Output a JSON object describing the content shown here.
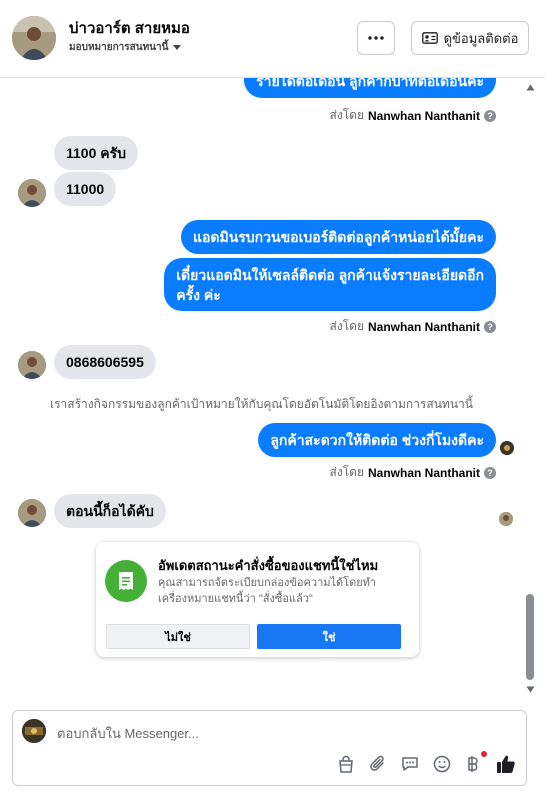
{
  "header": {
    "name": "บ่าวอาร์ต สายหมอ",
    "assign_label": "มอบหมายการสนทนานี้",
    "contact_button": "ดูข้อมูลติดต่อ"
  },
  "messages": {
    "top_partial": "รายได้ต่อเดือน ลูกค้ากี่บาทต่อเดือนคะ",
    "sent_by_prefix": "ส่งโดย",
    "agent_name": "Nanwhan Nanthanit",
    "in_1": "1100 ครับ",
    "in_2": "11000",
    "out_1": "แอดมินรบกวนขอเบอร์ติดต่อลูกค้าหน่อยได้มั้ยคะ",
    "out_2_line1": "เดี๋ยวแอดมินให้เซลล์ติดต่อ ลูกค้าแจ้งรายละเอียดอีก",
    "out_2_line2": "ครั้ง ค่ะ",
    "in_3": "0868606595",
    "system_note": "เราสร้างกิจกรรมของลูกค้าเป้าหมายให้กับคุณโดยอัตโนมัติโดยอิงตามการสนทนานี้",
    "out_3": "ลูกค้าสะดวกให้ติดต่อ ช่วงกี่โมงดีคะ",
    "in_4": "ตอนนี้ก็อได้คับ"
  },
  "order_card": {
    "title": "อัพเดตสถานะคำสั่งซื้อของแชทนี้ใช่ไหม",
    "text": "คุณสามารถจัดระเบียบกล่องข้อความได้โดยทำเครื่องหมายแชทนี้ว่า \"สั่งซื้อแล้ว\"",
    "no_label": "ไม่ใช่",
    "yes_label": "ใช่"
  },
  "composer": {
    "placeholder": "ตอบกลับใน Messenger..."
  },
  "icons": {
    "more": "more-horizontal-icon",
    "contact": "contact-card-icon",
    "dropdown": "caret-down-icon",
    "info": "question-icon",
    "receipt": "receipt-icon",
    "tools": [
      "shopping-bag-icon",
      "paperclip-icon",
      "saved-replies-icon",
      "emoji-icon",
      "baht-icon",
      "like-icon"
    ]
  },
  "colors": {
    "outgoing": "#0a7cff",
    "incoming": "#e4e6eb",
    "primary_button": "#1877f2",
    "order_green": "#44b036"
  }
}
